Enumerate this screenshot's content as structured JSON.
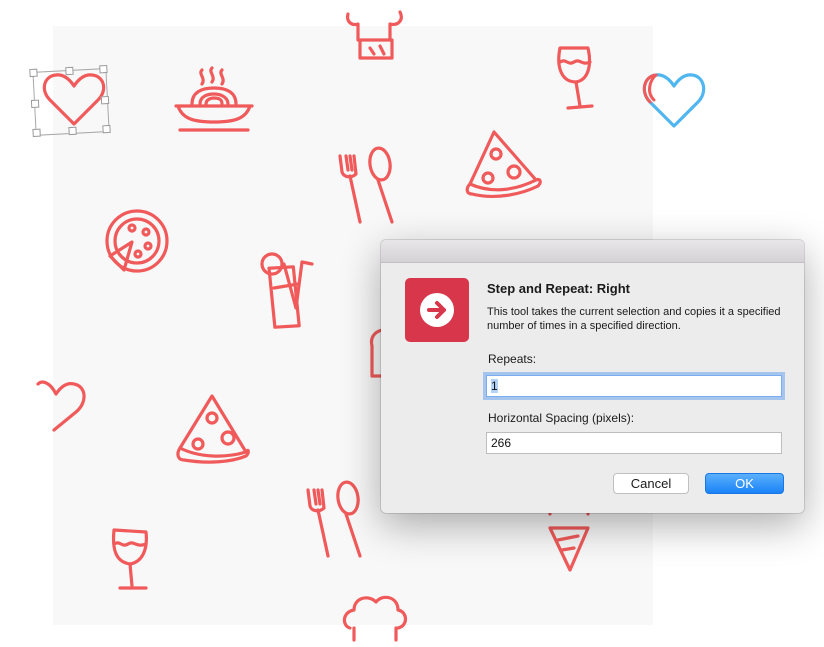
{
  "dialog": {
    "title": "Step and Repeat: Right",
    "description": "This tool takes the current selection and copies it a specified number of times in a specified direction.",
    "repeats_label": "Repeats:",
    "repeats_value": "1",
    "spacing_label": "Horizontal Spacing (pixels):",
    "spacing_value": "266",
    "cancel_label": "Cancel",
    "ok_label": "OK",
    "icon": "arrow-right-circle-icon"
  },
  "canvas": {
    "icons": [
      "heart-icon",
      "pasta-bowl-icon",
      "chef-hat-icon",
      "wine-glass-icon",
      "fork-spoon-icon",
      "pizza-slice-icon",
      "pizza-icon",
      "drink-glass-icon",
      "ice-cream-icon"
    ],
    "selected_object": "heart-icon",
    "duplicate_preview": "heart-icon"
  },
  "colors": {
    "icon": "#f05a5a",
    "preview": "#4fb6f0",
    "accent": "#1a82f7",
    "dialog_icon": "#d8364a"
  }
}
